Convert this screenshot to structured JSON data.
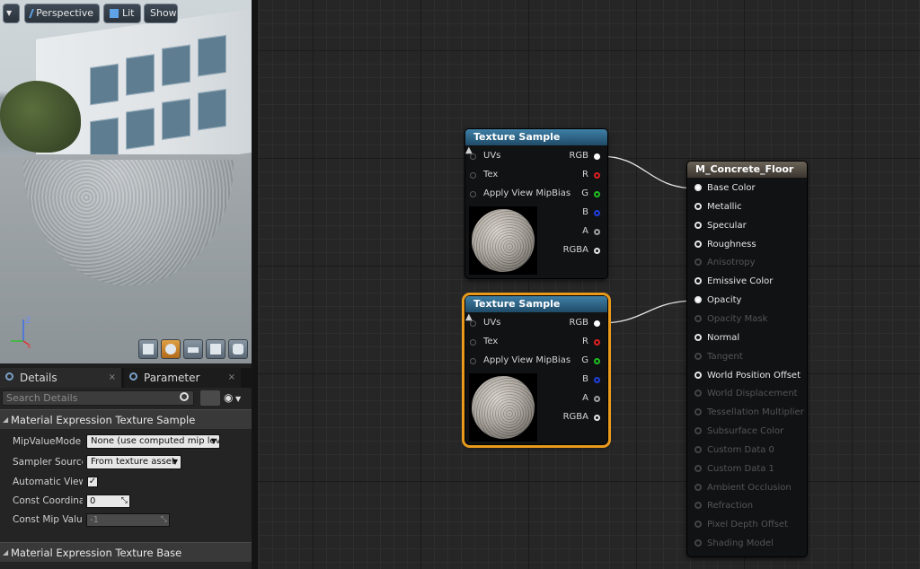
{
  "viewport": {
    "menu_icon": "dropdown-arrow-icon",
    "perspective_label": "Perspective",
    "lit_label": "Lit",
    "show_label": "Show",
    "axis_z": "Z",
    "preview_shapes": [
      "cylinder-shape-icon",
      "sphere-shape-icon",
      "plane-shape-icon",
      "cube-shape-icon",
      "custom-mesh-icon"
    ],
    "active_shape": "sphere"
  },
  "details": {
    "tabs": [
      {
        "label": "Details",
        "icon": "magnifier-icon"
      },
      {
        "label": "Parameter Defaults",
        "icon": "magnifier-icon"
      }
    ],
    "close_glyph": "×",
    "search_placeholder": "Search Details",
    "section1": "Material Expression Texture Sample",
    "section2": "Material Expression Texture Base",
    "props": {
      "mip_value_mode_label": "MipValueMode",
      "mip_value_mode_value": "None (use computed mip lev",
      "sampler_source_label": "Sampler Source",
      "sampler_source_value": "From texture asset",
      "automatic_view_label": "Automatic View M",
      "automatic_view_checked": true,
      "const_coordinate_label": "Const Coordinate",
      "const_coordinate_value": "0",
      "const_mip_label": "Const Mip Value",
      "const_mip_value": "-1"
    }
  },
  "graph": {
    "texture_nodes": [
      {
        "title": "Texture Sample",
        "selected": false,
        "inputs": [
          "UVs",
          "Tex",
          "Apply View MipBias"
        ],
        "outputs": [
          {
            "label": "RGB",
            "color": "#ffffff",
            "connected": true
          },
          {
            "label": "R",
            "color": "#e02020",
            "connected": false
          },
          {
            "label": "G",
            "color": "#20c020",
            "connected": false
          },
          {
            "label": "B",
            "color": "#2040e0",
            "connected": false
          },
          {
            "label": "A",
            "color": "#a0a0a0",
            "connected": false
          },
          {
            "label": "RGBA",
            "color": "#e6e6e6",
            "connected": false
          }
        ]
      },
      {
        "title": "Texture Sample",
        "selected": true,
        "inputs": [
          "UVs",
          "Tex",
          "Apply View MipBias"
        ],
        "outputs": [
          {
            "label": "RGB",
            "color": "#ffffff",
            "connected": true
          },
          {
            "label": "R",
            "color": "#e02020",
            "connected": false
          },
          {
            "label": "G",
            "color": "#20c020",
            "connected": false
          },
          {
            "label": "B",
            "color": "#2040e0",
            "connected": false
          },
          {
            "label": "A",
            "color": "#a0a0a0",
            "connected": false
          },
          {
            "label": "RGBA",
            "color": "#e6e6e6",
            "connected": false
          }
        ]
      }
    ],
    "material_node": {
      "title": "M_Concrete_Floor",
      "inputs": [
        {
          "label": "Base Color",
          "enabled": true,
          "connected": true
        },
        {
          "label": "Metallic",
          "enabled": true,
          "connected": false
        },
        {
          "label": "Specular",
          "enabled": true,
          "connected": false
        },
        {
          "label": "Roughness",
          "enabled": true,
          "connected": false
        },
        {
          "label": "Anisotropy",
          "enabled": false,
          "connected": false
        },
        {
          "label": "Emissive Color",
          "enabled": true,
          "connected": false
        },
        {
          "label": "Opacity",
          "enabled": true,
          "connected": true
        },
        {
          "label": "Opacity Mask",
          "enabled": false,
          "connected": false
        },
        {
          "label": "Normal",
          "enabled": true,
          "connected": false
        },
        {
          "label": "Tangent",
          "enabled": false,
          "connected": false
        },
        {
          "label": "World Position Offset",
          "enabled": true,
          "connected": false
        },
        {
          "label": "World Displacement",
          "enabled": false,
          "connected": false
        },
        {
          "label": "Tessellation Multiplier",
          "enabled": false,
          "connected": false
        },
        {
          "label": "Subsurface Color",
          "enabled": false,
          "connected": false
        },
        {
          "label": "Custom Data 0",
          "enabled": false,
          "connected": false
        },
        {
          "label": "Custom Data 1",
          "enabled": false,
          "connected": false
        },
        {
          "label": "Ambient Occlusion",
          "enabled": false,
          "connected": false
        },
        {
          "label": "Refraction",
          "enabled": false,
          "connected": false
        },
        {
          "label": "Pixel Depth Offset",
          "enabled": false,
          "connected": false
        },
        {
          "label": "Shading Model",
          "enabled": false,
          "connected": false
        }
      ]
    }
  }
}
